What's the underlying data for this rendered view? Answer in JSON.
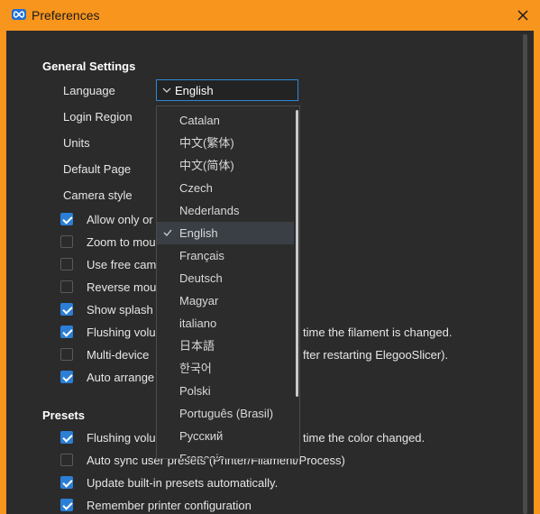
{
  "window": {
    "title": "Preferences"
  },
  "general": {
    "section_title": "General Settings",
    "rows": [
      {
        "label": "Language"
      },
      {
        "label": "Login Region"
      },
      {
        "label": "Units"
      },
      {
        "label": "Default Page"
      },
      {
        "label": "Camera style"
      }
    ],
    "checkboxes": [
      {
        "label": "Allow only or",
        "checked": true
      },
      {
        "label": "Zoom to mou",
        "checked": false
      },
      {
        "label": "Use free cam",
        "checked": false
      },
      {
        "label": "Reverse mou",
        "checked": false
      },
      {
        "label": "Show splash",
        "checked": true
      },
      {
        "label": "Flushing volu",
        "tail": "time the filament is changed.",
        "checked": true
      },
      {
        "label": "Multi-device",
        "tail": "fter restarting ElegooSlicer).",
        "checked": false
      },
      {
        "label": "Auto arrange",
        "checked": true
      }
    ]
  },
  "language_select": {
    "value": "English",
    "options": [
      "Catalan",
      "中文(繁体)",
      "中文(简体)",
      "Czech",
      "Nederlands",
      "English",
      "Français",
      "Deutsch",
      "Magyar",
      "italiano",
      "日本語",
      "한국어",
      "Polski",
      "Português (Brasil)",
      "Русский",
      "Français"
    ],
    "selected_index": 5
  },
  "presets": {
    "section_title": "Presets",
    "checkboxes": [
      {
        "label": "Flushing volu",
        "tail": "time the color changed.",
        "checked": true
      },
      {
        "label": "Auto sync user presets (Printer/Filament/Process)",
        "checked": false
      },
      {
        "label": "Update built-in presets automatically.",
        "checked": true
      },
      {
        "label": "Remember printer configuration",
        "checked": true
      }
    ]
  },
  "colors": {
    "titlebar": "#f8951d",
    "accent": "#2b7fd6",
    "background": "#2b2b2b"
  }
}
